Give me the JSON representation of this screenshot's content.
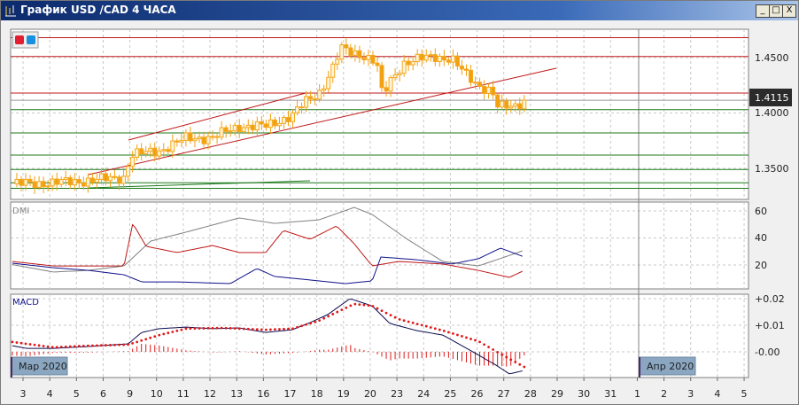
{
  "window": {
    "title": "График USD /CAD  4 ЧАСА",
    "minimize": "_",
    "maximize": "□",
    "close": "X"
  },
  "colors": {
    "bull": "#f5a81c",
    "bear": "#f0a010",
    "resistance": "#c01818",
    "support": "#1a7a1a",
    "adx": "#808080",
    "plus_di": "#c01818",
    "minus_di": "#10108a",
    "macd": "#0a0a50",
    "signal": "#e01818"
  },
  "chart_data": {
    "type": "candlestick",
    "title": "График USD /CAD  4 ЧАСА",
    "price_axis": {
      "ticks": [
        "1.4500",
        "1.4000",
        "1.3500"
      ],
      "tick_values": [
        1.45,
        1.4,
        1.35
      ],
      "current_price": "1.4115"
    },
    "x_axis": {
      "labels": [
        "3",
        "4",
        "5",
        "6",
        "9",
        "10",
        "11",
        "12",
        "13",
        "16",
        "17",
        "18",
        "19",
        "20",
        "23",
        "24",
        "25",
        "26",
        "27",
        "28",
        "29",
        "30",
        "31",
        "1",
        "2",
        "3",
        "4",
        "5"
      ],
      "month_labels": [
        "Мар 2020",
        "Апр 2020"
      ]
    },
    "candles_per_day": 6,
    "close_keyframes": [
      [
        -0.4,
        1.336
      ],
      [
        1.13,
        1.337
      ],
      [
        2.45,
        1.339
      ],
      [
        3.78,
        1.342
      ],
      [
        4.05,
        1.362
      ],
      [
        5.1,
        1.366
      ],
      [
        6.1,
        1.377
      ],
      [
        7.1,
        1.378
      ],
      [
        8.09,
        1.388
      ],
      [
        9.09,
        1.388
      ],
      [
        10.08,
        1.398
      ],
      [
        10.58,
        1.41
      ],
      [
        11.08,
        1.418
      ],
      [
        11.58,
        1.44
      ],
      [
        11.9,
        1.458
      ],
      [
        12.24,
        1.455
      ],
      [
        12.74,
        1.452
      ],
      [
        13.23,
        1.446
      ],
      [
        13.46,
        1.415
      ],
      [
        13.73,
        1.428
      ],
      [
        14.23,
        1.445
      ],
      [
        14.73,
        1.448
      ],
      [
        15.39,
        1.451
      ],
      [
        16.05,
        1.449
      ],
      [
        16.55,
        1.435
      ],
      [
        17.05,
        1.425
      ],
      [
        17.55,
        1.42
      ],
      [
        17.78,
        1.405
      ],
      [
        18.38,
        1.406
      ],
      [
        18.77,
        1.4115
      ]
    ],
    "levels": {
      "resistance": [
        1.468,
        1.451,
        1.418
      ],
      "support": [
        1.403,
        1.382,
        1.362,
        1.349,
        1.337,
        1.332
      ]
    },
    "dmi": {
      "label": "DMI",
      "ticks": [
        "60",
        "40",
        "20"
      ],
      "tick_values": [
        60,
        40,
        20
      ],
      "adx": [
        [
          -0.4,
          20.3
        ],
        [
          1.13,
          14.8
        ],
        [
          2.45,
          16
        ],
        [
          3.78,
          19.3
        ],
        [
          4.78,
          37.7
        ],
        [
          6.1,
          44.3
        ],
        [
          8.09,
          54.8
        ],
        [
          9.42,
          50.8
        ],
        [
          11.08,
          53.4
        ],
        [
          12.4,
          62.6
        ],
        [
          13.07,
          57.4
        ],
        [
          14.39,
          39
        ],
        [
          15.72,
          22.6
        ],
        [
          17.05,
          19.3
        ],
        [
          18.04,
          25.9
        ],
        [
          18.71,
          30.5
        ]
      ],
      "plus_di": [
        [
          -0.4,
          22.6
        ],
        [
          1.13,
          19.3
        ],
        [
          2.45,
          19.3
        ],
        [
          3.78,
          19.3
        ],
        [
          4.11,
          50.8
        ],
        [
          4.61,
          33.8
        ],
        [
          5.77,
          29.2
        ],
        [
          7.1,
          34.4
        ],
        [
          8.09,
          29.2
        ],
        [
          9.09,
          29.2
        ],
        [
          9.75,
          45.6
        ],
        [
          10.75,
          39
        ],
        [
          11.74,
          48.9
        ],
        [
          12.4,
          35.7
        ],
        [
          13.07,
          19.3
        ],
        [
          14.06,
          22.6
        ],
        [
          15.72,
          20.7
        ],
        [
          17.05,
          16
        ],
        [
          18.21,
          10.8
        ],
        [
          18.77,
          16
        ]
      ],
      "minus_di": [
        [
          -0.4,
          21.3
        ],
        [
          1.13,
          18
        ],
        [
          2.45,
          16
        ],
        [
          3.78,
          12.8
        ],
        [
          4.44,
          7.5
        ],
        [
          5.77,
          7.5
        ],
        [
          7.76,
          6.2
        ],
        [
          8.76,
          17.4
        ],
        [
          9.42,
          11.5
        ],
        [
          10.75,
          8.9
        ],
        [
          12.07,
          6.2
        ],
        [
          13.07,
          8.2
        ],
        [
          13.4,
          25.9
        ],
        [
          14.73,
          23.9
        ],
        [
          16.05,
          20.7
        ],
        [
          17.05,
          24.6
        ],
        [
          17.88,
          32.5
        ],
        [
          18.77,
          25.9
        ]
      ]
    },
    "macd": {
      "label": "MACD",
      "ticks": [
        "+0.02",
        "+0.01",
        "-0.00"
      ],
      "tick_values": [
        0.02,
        0.01,
        0
      ],
      "main": [
        [
          -0.4,
          0.0023
        ],
        [
          0.13,
          0.0013
        ],
        [
          1.13,
          0.0013
        ],
        [
          2.45,
          0.002
        ],
        [
          3.94,
          0.003
        ],
        [
          4.44,
          0.0073
        ],
        [
          5.1,
          0.0087
        ],
        [
          6.1,
          0.0093
        ],
        [
          7.1,
          0.0087
        ],
        [
          8.09,
          0.009
        ],
        [
          9.09,
          0.0073
        ],
        [
          10.08,
          0.0083
        ],
        [
          10.75,
          0.011
        ],
        [
          11.41,
          0.014
        ],
        [
          12.24,
          0.02
        ],
        [
          13.07,
          0.0173
        ],
        [
          13.73,
          0.0107
        ],
        [
          14.73,
          0.008
        ],
        [
          15.72,
          0.0063
        ],
        [
          16.72,
          0.0007
        ],
        [
          17.71,
          -0.005
        ],
        [
          18.21,
          -0.0083
        ],
        [
          18.77,
          -0.007
        ]
      ],
      "signal": [
        [
          -0.4,
          0.0037
        ],
        [
          1.13,
          0.0017
        ],
        [
          2.45,
          0.0023
        ],
        [
          3.94,
          0.0027
        ],
        [
          5.1,
          0.0063
        ],
        [
          6.1,
          0.0087
        ],
        [
          7.43,
          0.009
        ],
        [
          9.09,
          0.0083
        ],
        [
          10.08,
          0.0087
        ],
        [
          11.08,
          0.0117
        ],
        [
          12.4,
          0.018
        ],
        [
          13.07,
          0.0173
        ],
        [
          14.06,
          0.0123
        ],
        [
          15.72,
          0.008
        ],
        [
          17.05,
          0.004
        ],
        [
          18.04,
          -0.0017
        ],
        [
          18.77,
          -0.0057
        ]
      ]
    }
  }
}
